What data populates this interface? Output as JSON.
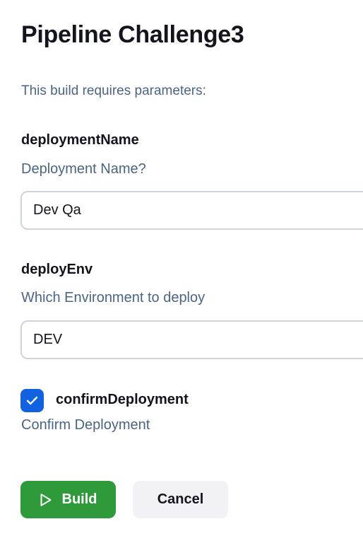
{
  "page": {
    "title": "Pipeline Challenge3",
    "subtitle": "This build requires parameters:"
  },
  "parameters": [
    {
      "name": "deploymentName",
      "description": "Deployment Name?",
      "value": "Dev Qa"
    },
    {
      "name": "deployEnv",
      "description": "Which Environment to deploy",
      "value": "DEV"
    },
    {
      "name": "confirmDeployment",
      "description": "Confirm Deployment",
      "checked": true
    }
  ],
  "actions": {
    "build_label": "Build",
    "cancel_label": "Cancel"
  },
  "icons": {
    "build": "play-icon",
    "checkbox": "check-icon"
  },
  "colors": {
    "build_button": "#2e9a3a",
    "checkbox": "#1261e0",
    "description_text": "#4a6583",
    "cancel_button": "#f2f2f6"
  }
}
